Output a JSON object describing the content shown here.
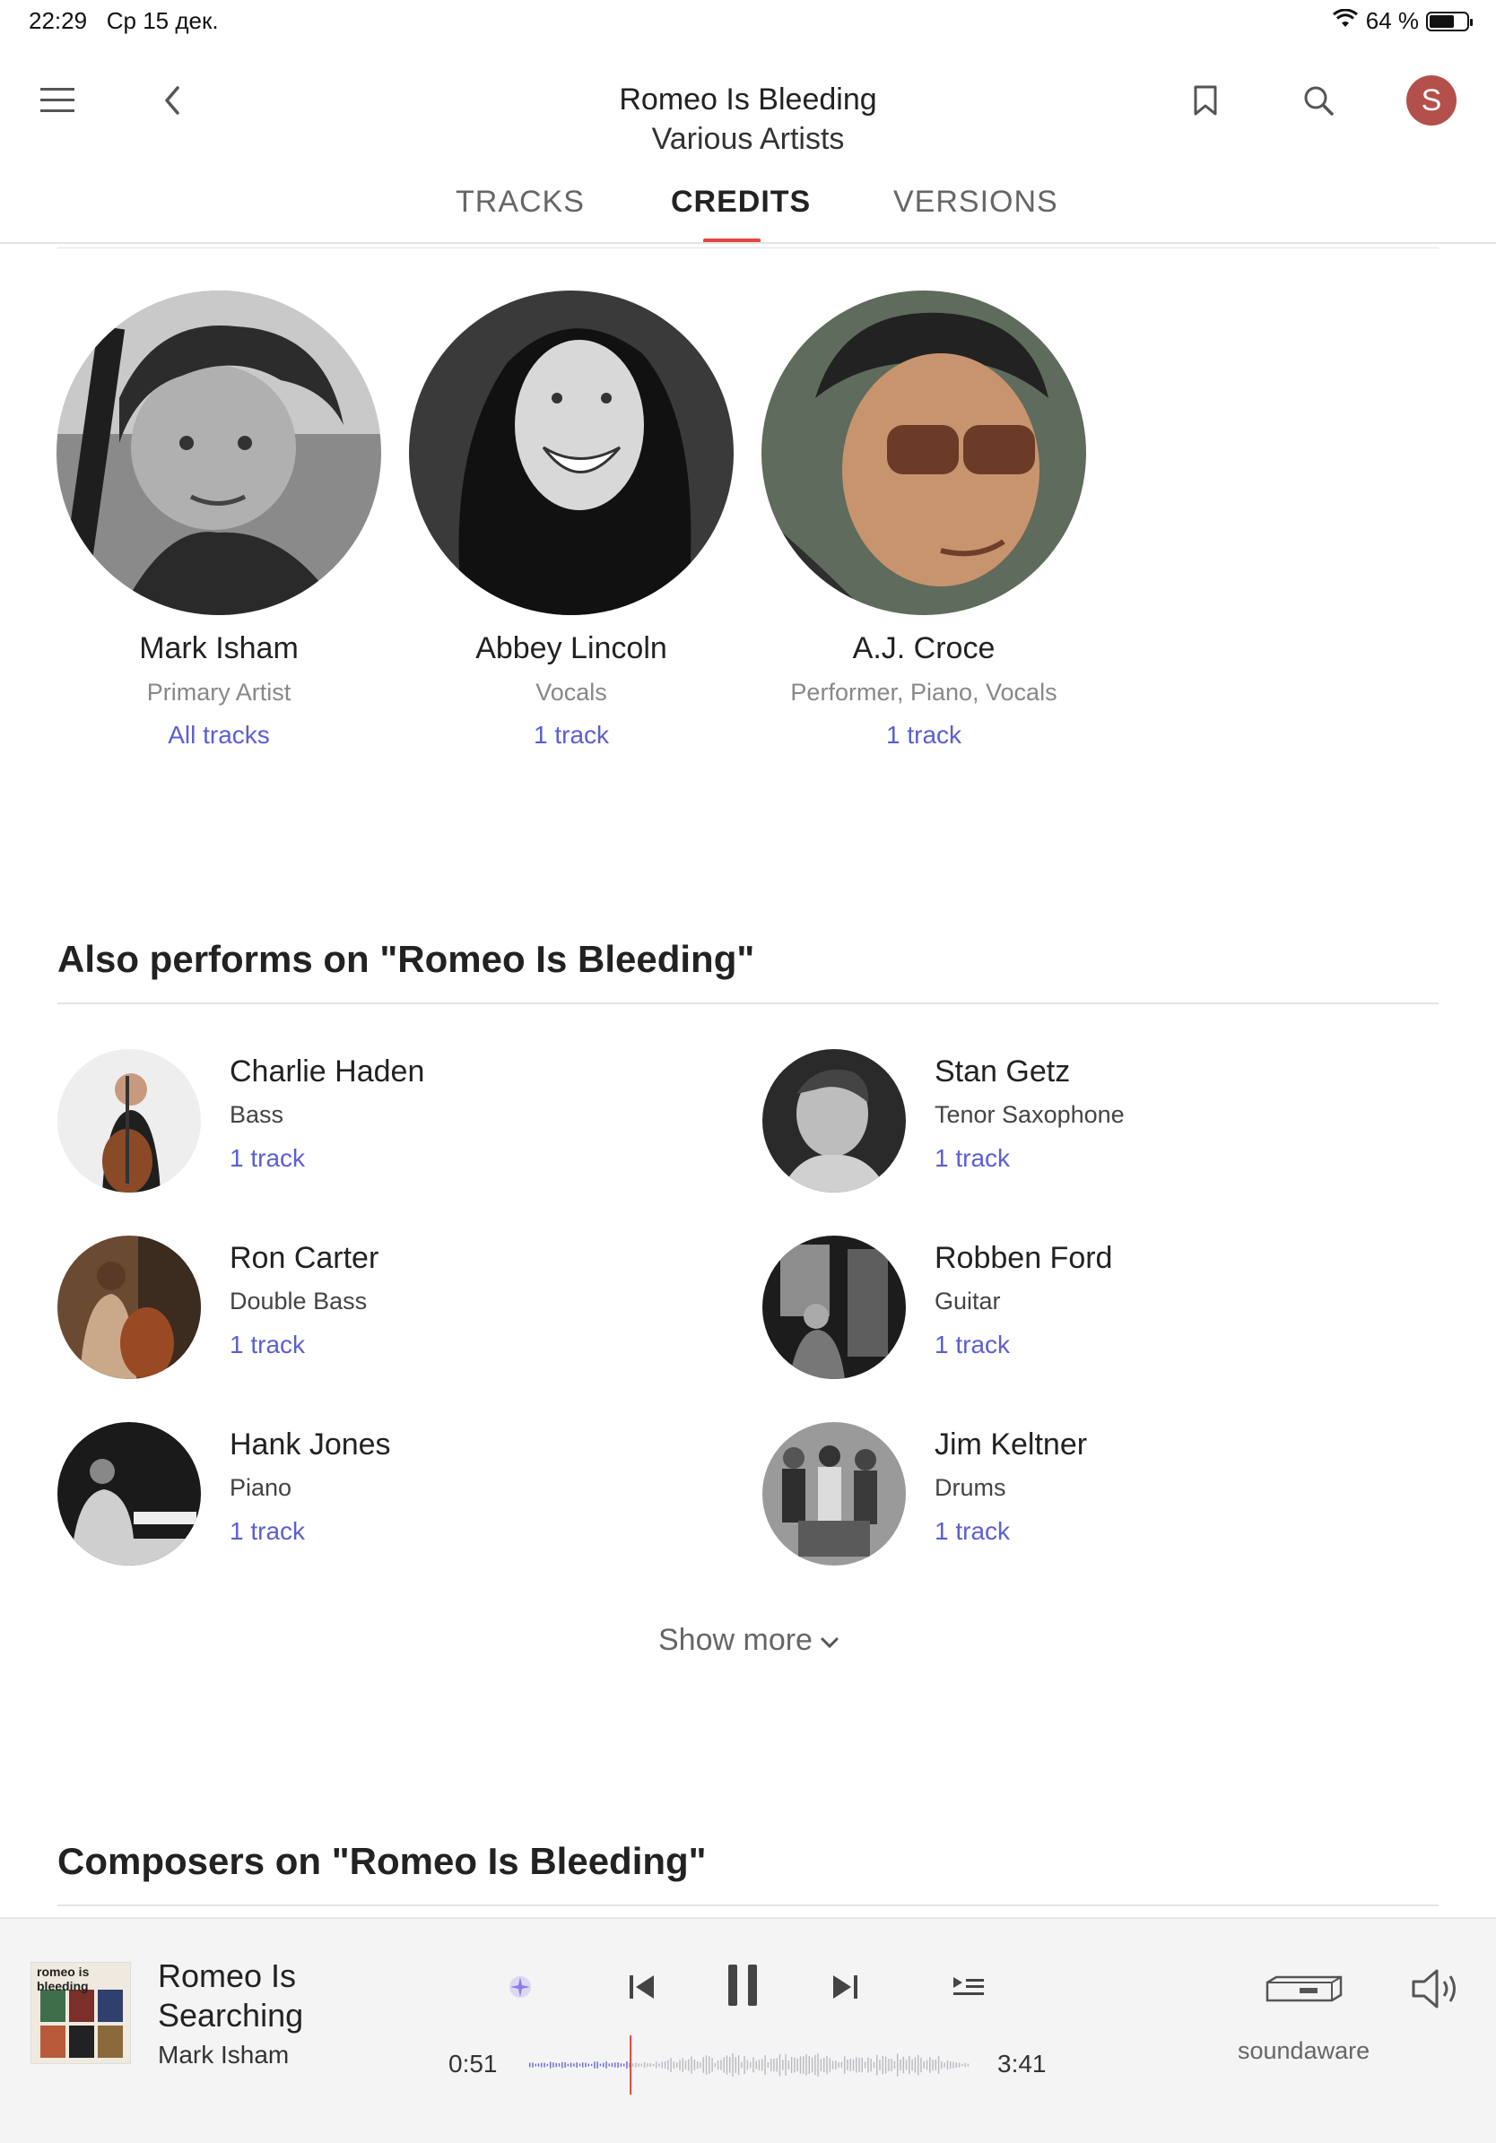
{
  "status_bar": {
    "time": "22:29",
    "date": "Ср 15 дек.",
    "battery": "64 %"
  },
  "header": {
    "title": "Romeo Is Bleeding",
    "subtitle": "Various Artists",
    "avatar_letter": "S",
    "avatar_color": "#b4504b"
  },
  "tabs": [
    {
      "label": "TRACKS",
      "active": false
    },
    {
      "label": "CREDITS",
      "active": true
    },
    {
      "label": "VERSIONS",
      "active": false
    }
  ],
  "main_artists": [
    {
      "name": "Mark Isham",
      "role": "Primary Artist",
      "link": "All tracks"
    },
    {
      "name": "Abbey Lincoln",
      "role": "Vocals",
      "link": "1 track"
    },
    {
      "name": "A.J. Croce",
      "role": "Performer, Piano, Vocals",
      "link": "1 track"
    }
  ],
  "also_performs": {
    "title": "Also performs on \"Romeo Is Bleeding\"",
    "performers": [
      {
        "name": "Charlie Haden",
        "role": "Bass",
        "link": "1 track"
      },
      {
        "name": "Stan Getz",
        "role": "Tenor Saxophone",
        "link": "1 track"
      },
      {
        "name": "Ron Carter",
        "role": "Double Bass",
        "link": "1 track"
      },
      {
        "name": "Robben Ford",
        "role": "Guitar",
        "link": "1 track"
      },
      {
        "name": "Hank Jones",
        "role": "Piano",
        "link": "1 track"
      },
      {
        "name": "Jim Keltner",
        "role": "Drums",
        "link": "1 track"
      }
    ],
    "show_more": "Show more"
  },
  "composers": {
    "title": "Composers on \"Romeo Is Bleeding\""
  },
  "player": {
    "title": "Romeo Is Searching",
    "artist": "Mark Isham",
    "elapsed": "0:51",
    "duration": "3:41",
    "progress": 0.23,
    "device": "soundaware",
    "cover_text": "romeo is bleeding"
  },
  "colors": {
    "accent": "#e2463f",
    "link": "#5b5fd1"
  }
}
